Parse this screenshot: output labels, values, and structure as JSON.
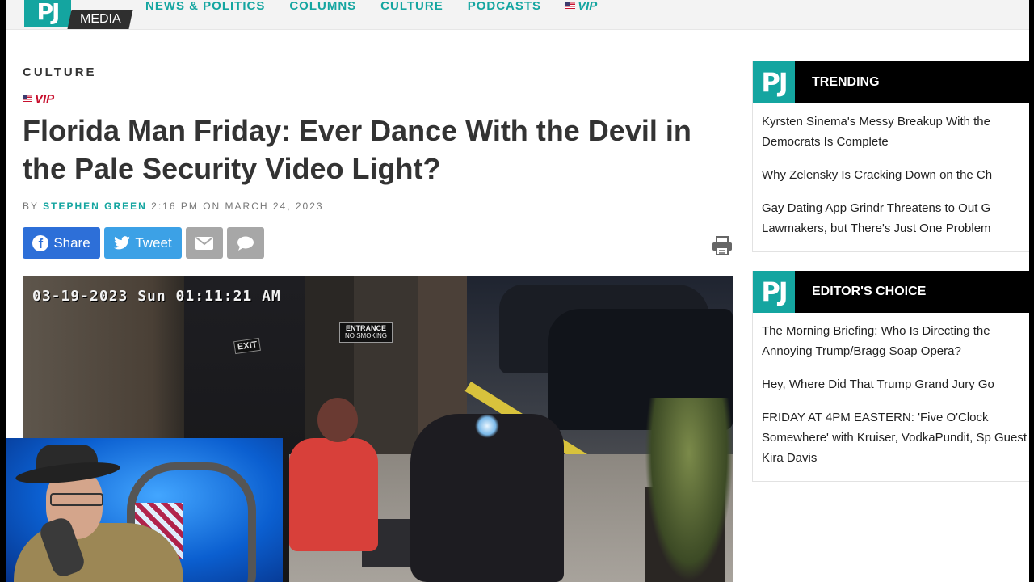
{
  "site": {
    "logo_pj": "PJ",
    "logo_media": "MEDIA"
  },
  "nav": {
    "items": [
      "NEWS & POLITICS",
      "COLUMNS",
      "CULTURE",
      "PODCASTS"
    ],
    "vip_label": "VIP"
  },
  "article": {
    "category": "CULTURE",
    "vip_label": "VIP",
    "headline": "Florida Man Friday: Ever Dance With the Devil in the Pale Security Video Light?",
    "by_label": "BY",
    "author": "STEPHEN GREEN",
    "time": "2:16 PM ON MARCH 24, 2023"
  },
  "share": {
    "facebook_label": "Share",
    "twitter_label": "Tweet"
  },
  "video": {
    "timestamp": "03-19-2023 Sun 01:11:21 AM",
    "sign_exit": "EXIT",
    "sign_entrance": "ENTRANCE",
    "sign_no_smoking": "NO SMOKING"
  },
  "sidebar": {
    "trending": {
      "logo": "PJ",
      "title": "TRENDING",
      "items": [
        "Kyrsten Sinema's Messy Breakup With the Democrats Is Complete",
        "Why Zelensky Is Cracking Down on the Ch",
        "Gay Dating App Grindr Threatens to Out G Lawmakers, but There's Just One Problem"
      ]
    },
    "editors_choice": {
      "logo": "PJ",
      "title": "EDITOR'S CHOICE",
      "items": [
        "The Morning Briefing: Who Is Directing the Annoying Trump/Bragg Soap Opera?",
        "Hey, Where Did That Trump Grand Jury Go",
        "FRIDAY AT 4PM EASTERN: 'Five O'Clock Somewhere' with Kruiser, VodkaPundit, Sp Guest Kira Davis"
      ]
    }
  },
  "colors": {
    "brand_teal": "#14a5a0",
    "vip_red": "#c8102e",
    "facebook_blue": "#2d6fd8",
    "twitter_blue": "#3ca1e6"
  },
  "icons": [
    "facebook-icon",
    "twitter-icon",
    "email-icon",
    "comment-icon",
    "print-icon",
    "flag-icon"
  ]
}
